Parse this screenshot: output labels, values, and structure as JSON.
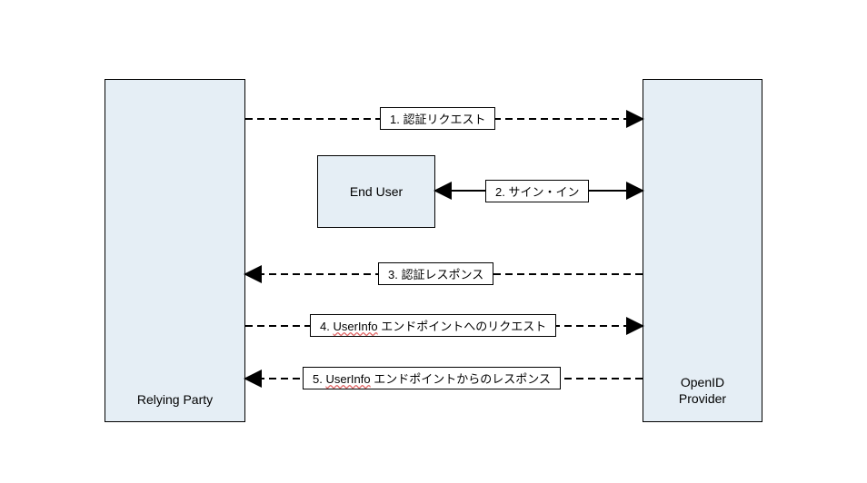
{
  "nodes": {
    "relyingParty": {
      "label": "Relying Party"
    },
    "openIdProvider": {
      "label_line1": "OpenID",
      "label_line2": "Provider"
    },
    "endUser": {
      "label": "End User"
    }
  },
  "messages": {
    "m1": "1. 認証リクエスト",
    "m2": "2. サイン・イン",
    "m3": "3. 認証レスポンス",
    "m4_prefix": "4. ",
    "m4_spell": "UserInfo",
    "m4_suffix": " エンドポイントへのリクエスト",
    "m5_prefix": "5. ",
    "m5_spell": "UserInfo",
    "m5_suffix": " エンドポイントからのレスポンス"
  }
}
